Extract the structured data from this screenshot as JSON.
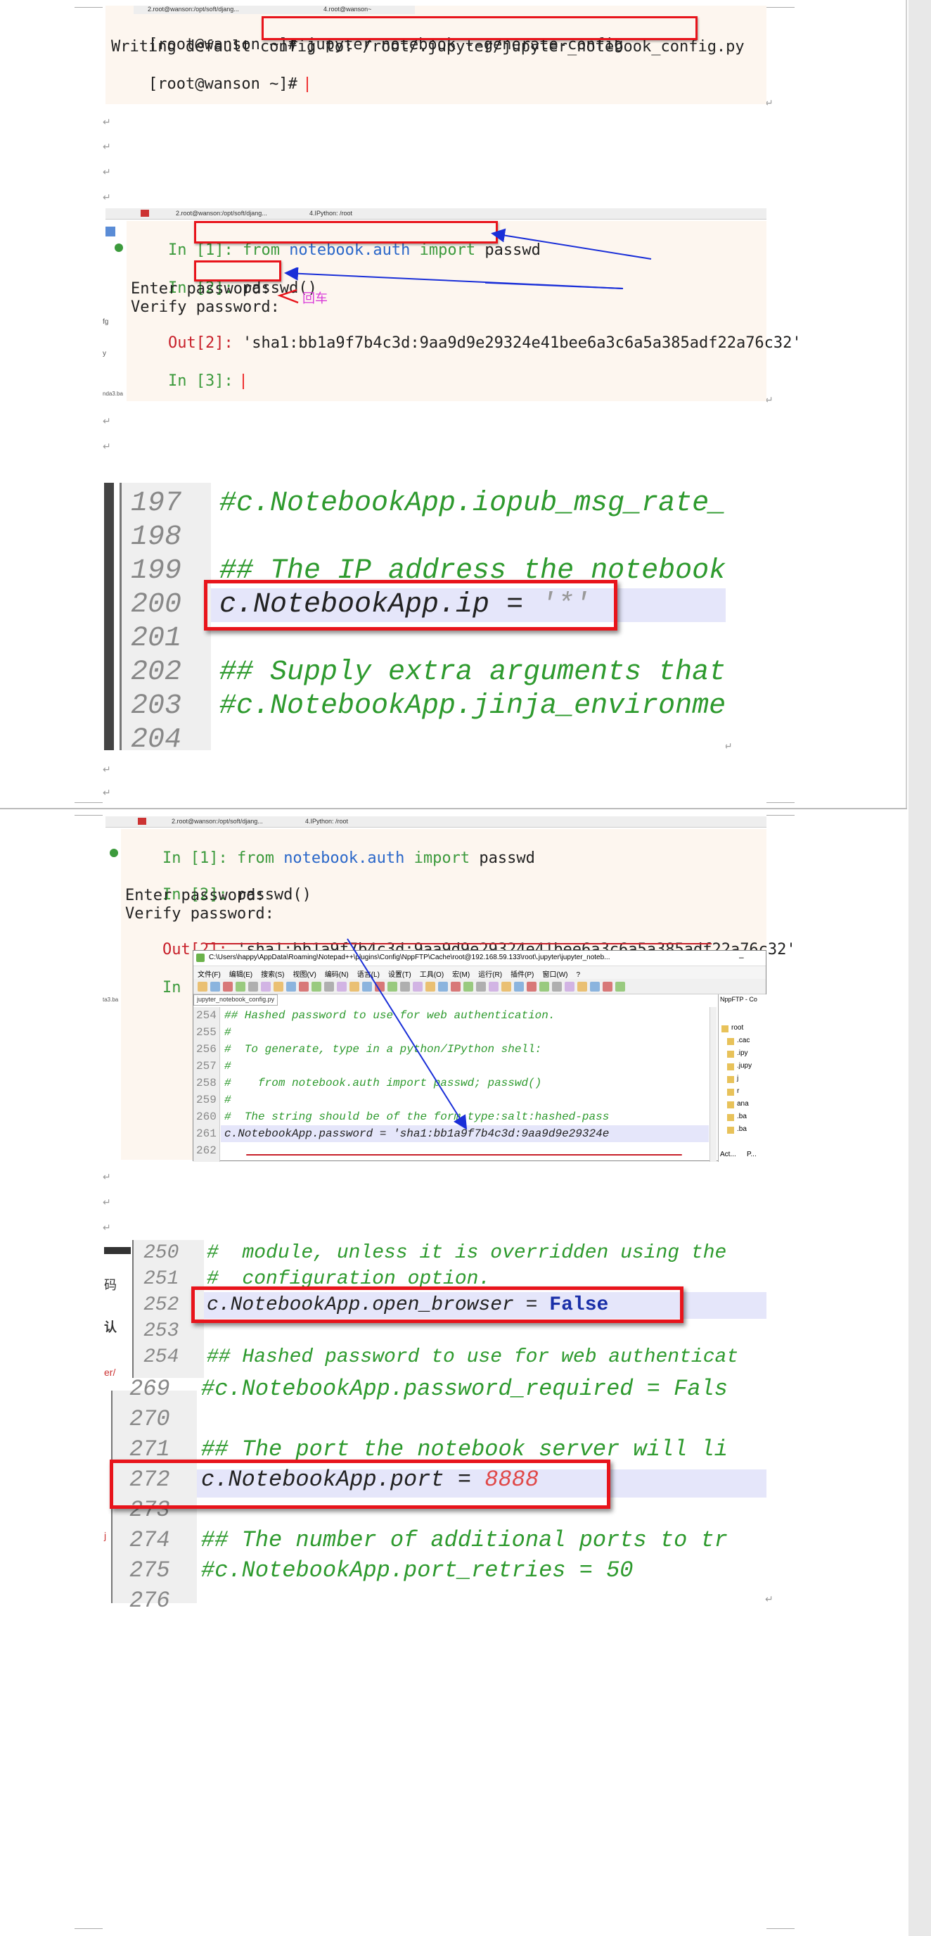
{
  "terminal1": {
    "prompt1": "[root@wanson ~]#",
    "command": "jupyter notebook --generate-config",
    "output": "Writing default config to: /root/.jupyter/jupyter_notebook_config.py",
    "prompt2": "[root@wanson ~]#",
    "tabs": [
      "2.root@wanson:/opt/soft/djang...",
      "4.root@wanson~"
    ]
  },
  "ipython1": {
    "tabs": [
      "2.root@wanson:/opt/soft/djang...",
      "4.IPython: /root"
    ],
    "in1_prompt": "In [1]:",
    "in1_code_from": "from",
    "in1_code_mod": "notebook.auth",
    "in1_code_import": "import",
    "in1_code_name": "passwd",
    "in2_prompt": "In [2]:",
    "in2_code": "passwd()",
    "enter_pw": "Enter password:",
    "verify_pw": "Verify password:",
    "annotation": "回车",
    "out2_prompt": "Out[2]:",
    "out2_value": "'sha1:bb1a9f7b4c3d:9aa9d9e29324e41bee6a3c6a5a385adf22a76c32'",
    "in3_prompt": "In [3]:"
  },
  "editor1": {
    "lines": [
      {
        "n": "197",
        "text": "#c.NotebookApp.iopub_msg_rate_l",
        "kind": "comment"
      },
      {
        "n": "198",
        "text": "",
        "kind": "blank"
      },
      {
        "n": "199",
        "text": "## The IP address the notebook",
        "kind": "comment"
      },
      {
        "n": "200",
        "text": "c.NotebookApp.ip = '*'",
        "kind": "code"
      },
      {
        "n": "201",
        "text": "",
        "kind": "blank"
      },
      {
        "n": "202",
        "text": "## Supply extra arguments that",
        "kind": "comment"
      },
      {
        "n": "203",
        "text": "#c.NotebookApp.jinja_environmen",
        "kind": "comment"
      },
      {
        "n": "204",
        "text": "",
        "kind": "blank"
      }
    ],
    "code_main": "c.NotebookApp.ip = ",
    "code_val": "'*'"
  },
  "ipython2": {
    "tabs": [
      "2.root@wanson:/opt/soft/djang...",
      "4.IPython: /root"
    ],
    "in1_prompt": "In [1]:",
    "in1_code_from": "from",
    "in1_code_mod": "notebook.auth",
    "in1_code_import": "import",
    "in1_code_name": "passwd",
    "in2_prompt": "In [2]:",
    "in2_code": "passwd()",
    "enter_pw": "Enter password:",
    "verify_pw": "Verify password:",
    "out2_prompt": "Out[2]:",
    "out2_value": "'sha1:bb1a9f7b4c3d:9aa9d9e29324e41bee6a3c6a5a385adf22a76c32'",
    "in3_prompt": "In [3]:"
  },
  "notepad": {
    "title": "C:\\Users\\happy\\AppData\\Roaming\\Notepad++\\plugins\\Config\\NppFTP\\Cache\\root@192.168.59.133\\root\\.jupyter\\jupyter_noteb...",
    "menu": [
      "文件(F)",
      "编辑(E)",
      "搜索(S)",
      "视图(V)",
      "编码(N)",
      "语言(L)",
      "设置(T)",
      "工具(O)",
      "宏(M)",
      "运行(R)",
      "插件(P)",
      "窗口(W)",
      "?"
    ],
    "filetab": "jupyter_notebook_config.py",
    "lines": [
      {
        "n": "254",
        "text": "## Hashed password to use for web authentication."
      },
      {
        "n": "255",
        "text": "#"
      },
      {
        "n": "256",
        "text": "#  To generate, type in a python/IPython shell:"
      },
      {
        "n": "257",
        "text": "#"
      },
      {
        "n": "258",
        "text": "#    from notebook.auth import passwd; passwd()"
      },
      {
        "n": "259",
        "text": "#"
      },
      {
        "n": "260",
        "text": "#  The string should be of the form type:salt:hashed-pass"
      },
      {
        "n": "261",
        "text": "c.NotebookApp.password = 'sha1:bb1a9f7b4c3d:9aa9d9e29324e"
      },
      {
        "n": "262",
        "text": ""
      }
    ],
    "side_title": "NppFTP - Co",
    "side_items": [
      "root",
      ".cac",
      ".ipy",
      ".jupy",
      "j",
      "r",
      "ana",
      ".ba",
      ".ba"
    ],
    "side_bottom": [
      "Act...",
      "P..."
    ]
  },
  "editor2": {
    "lines": [
      {
        "n": "250",
        "text": "#  module, unless it is overridden using the"
      },
      {
        "n": "251",
        "text": "#  configuration option."
      },
      {
        "n": "252",
        "text": "c.NotebookApp.open_browser = False"
      },
      {
        "n": "253",
        "text": ""
      },
      {
        "n": "254",
        "text": "## Hashed password to use for web authenticat"
      }
    ],
    "code_main": "c.NotebookApp.open_browser = ",
    "code_val": "False"
  },
  "editor3": {
    "lines": [
      {
        "n": "269",
        "text": "#c.NotebookApp.password_required = Fals"
      },
      {
        "n": "270",
        "text": ""
      },
      {
        "n": "271",
        "text": "## The port the notebook server will li"
      },
      {
        "n": "272",
        "text": "c.NotebookApp.port = 8888"
      },
      {
        "n": "273",
        "text": ""
      },
      {
        "n": "274",
        "text": "## The number of additional ports to tr"
      },
      {
        "n": "275",
        "text": "#c.NotebookApp.port_retries = 50"
      },
      {
        "n": "276",
        "text": ""
      }
    ],
    "code_main": "c.NotebookApp.port = ",
    "code_val": "8888"
  },
  "side_fragments": [
    "fg",
    "y",
    "nda3.ba",
    "ta3.ba",
    "码",
    "认",
    "er/",
    "j"
  ],
  "colors": {
    "red_box": "#e8141b",
    "arrow_blue": "#1a2fd8",
    "comment_green": "#2e9a2e",
    "keyword_blue": "#2a67c9",
    "out_red": "#c8202a",
    "highlight": "#e5e6fa"
  }
}
